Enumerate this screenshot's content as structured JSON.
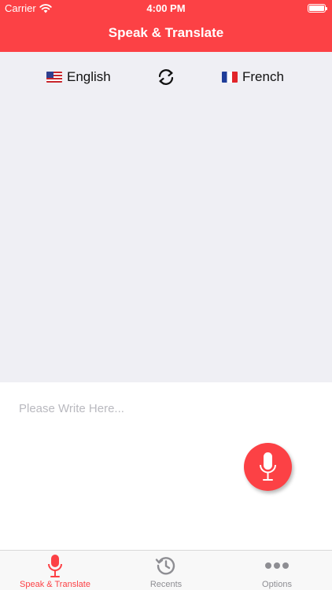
{
  "status_bar": {
    "carrier": "Carrier",
    "time": "4:00 PM"
  },
  "header": {
    "title": "Speak & Translate"
  },
  "languages": {
    "source": {
      "label": "English",
      "flag": "us-flag-icon"
    },
    "target": {
      "label": "French",
      "flag": "france-flag-icon"
    },
    "swap_icon": "swap-arrows-icon"
  },
  "input": {
    "value": "",
    "placeholder": "Please Write Here..."
  },
  "mic_icon": "microphone-icon",
  "tabbar": {
    "tabs": [
      {
        "label": "Speak & Translate",
        "icon": "microphone-icon",
        "active": true
      },
      {
        "label": "Recents",
        "icon": "history-icon",
        "active": false
      },
      {
        "label": "Options",
        "icon": "more-dots-icon",
        "active": false
      }
    ]
  },
  "colors": {
    "accent": "#fc4145",
    "background": "#efeff4",
    "inactive": "#8e8e93"
  }
}
